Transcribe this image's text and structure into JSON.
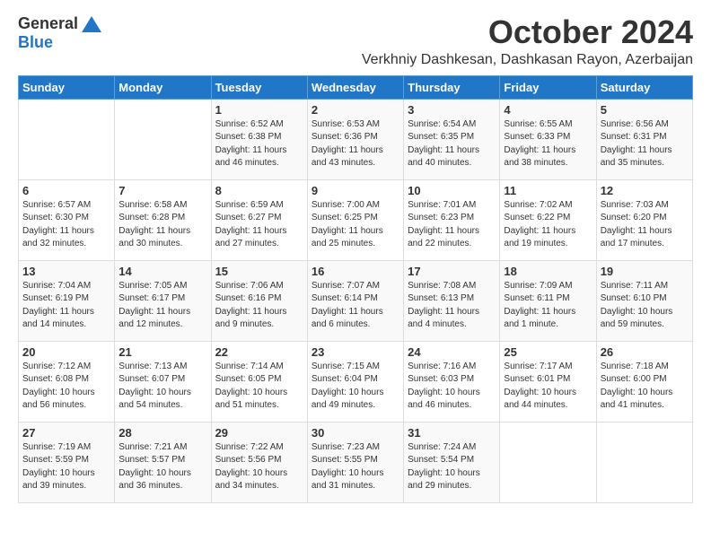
{
  "logo": {
    "general": "General",
    "blue": "Blue",
    "tagline": ""
  },
  "title": "October 2024",
  "location": "Verkhniy Dashkesan, Dashkasan Rayon, Azerbaijan",
  "days_of_week": [
    "Sunday",
    "Monday",
    "Tuesday",
    "Wednesday",
    "Thursday",
    "Friday",
    "Saturday"
  ],
  "weeks": [
    [
      {
        "day": "",
        "info": ""
      },
      {
        "day": "",
        "info": ""
      },
      {
        "day": "1",
        "info": "Sunrise: 6:52 AM\nSunset: 6:38 PM\nDaylight: 11 hours and 46 minutes."
      },
      {
        "day": "2",
        "info": "Sunrise: 6:53 AM\nSunset: 6:36 PM\nDaylight: 11 hours and 43 minutes."
      },
      {
        "day": "3",
        "info": "Sunrise: 6:54 AM\nSunset: 6:35 PM\nDaylight: 11 hours and 40 minutes."
      },
      {
        "day": "4",
        "info": "Sunrise: 6:55 AM\nSunset: 6:33 PM\nDaylight: 11 hours and 38 minutes."
      },
      {
        "day": "5",
        "info": "Sunrise: 6:56 AM\nSunset: 6:31 PM\nDaylight: 11 hours and 35 minutes."
      }
    ],
    [
      {
        "day": "6",
        "info": "Sunrise: 6:57 AM\nSunset: 6:30 PM\nDaylight: 11 hours and 32 minutes."
      },
      {
        "day": "7",
        "info": "Sunrise: 6:58 AM\nSunset: 6:28 PM\nDaylight: 11 hours and 30 minutes."
      },
      {
        "day": "8",
        "info": "Sunrise: 6:59 AM\nSunset: 6:27 PM\nDaylight: 11 hours and 27 minutes."
      },
      {
        "day": "9",
        "info": "Sunrise: 7:00 AM\nSunset: 6:25 PM\nDaylight: 11 hours and 25 minutes."
      },
      {
        "day": "10",
        "info": "Sunrise: 7:01 AM\nSunset: 6:23 PM\nDaylight: 11 hours and 22 minutes."
      },
      {
        "day": "11",
        "info": "Sunrise: 7:02 AM\nSunset: 6:22 PM\nDaylight: 11 hours and 19 minutes."
      },
      {
        "day": "12",
        "info": "Sunrise: 7:03 AM\nSunset: 6:20 PM\nDaylight: 11 hours and 17 minutes."
      }
    ],
    [
      {
        "day": "13",
        "info": "Sunrise: 7:04 AM\nSunset: 6:19 PM\nDaylight: 11 hours and 14 minutes."
      },
      {
        "day": "14",
        "info": "Sunrise: 7:05 AM\nSunset: 6:17 PM\nDaylight: 11 hours and 12 minutes."
      },
      {
        "day": "15",
        "info": "Sunrise: 7:06 AM\nSunset: 6:16 PM\nDaylight: 11 hours and 9 minutes."
      },
      {
        "day": "16",
        "info": "Sunrise: 7:07 AM\nSunset: 6:14 PM\nDaylight: 11 hours and 6 minutes."
      },
      {
        "day": "17",
        "info": "Sunrise: 7:08 AM\nSunset: 6:13 PM\nDaylight: 11 hours and 4 minutes."
      },
      {
        "day": "18",
        "info": "Sunrise: 7:09 AM\nSunset: 6:11 PM\nDaylight: 11 hours and 1 minute."
      },
      {
        "day": "19",
        "info": "Sunrise: 7:11 AM\nSunset: 6:10 PM\nDaylight: 10 hours and 59 minutes."
      }
    ],
    [
      {
        "day": "20",
        "info": "Sunrise: 7:12 AM\nSunset: 6:08 PM\nDaylight: 10 hours and 56 minutes."
      },
      {
        "day": "21",
        "info": "Sunrise: 7:13 AM\nSunset: 6:07 PM\nDaylight: 10 hours and 54 minutes."
      },
      {
        "day": "22",
        "info": "Sunrise: 7:14 AM\nSunset: 6:05 PM\nDaylight: 10 hours and 51 minutes."
      },
      {
        "day": "23",
        "info": "Sunrise: 7:15 AM\nSunset: 6:04 PM\nDaylight: 10 hours and 49 minutes."
      },
      {
        "day": "24",
        "info": "Sunrise: 7:16 AM\nSunset: 6:03 PM\nDaylight: 10 hours and 46 minutes."
      },
      {
        "day": "25",
        "info": "Sunrise: 7:17 AM\nSunset: 6:01 PM\nDaylight: 10 hours and 44 minutes."
      },
      {
        "day": "26",
        "info": "Sunrise: 7:18 AM\nSunset: 6:00 PM\nDaylight: 10 hours and 41 minutes."
      }
    ],
    [
      {
        "day": "27",
        "info": "Sunrise: 7:19 AM\nSunset: 5:59 PM\nDaylight: 10 hours and 39 minutes."
      },
      {
        "day": "28",
        "info": "Sunrise: 7:21 AM\nSunset: 5:57 PM\nDaylight: 10 hours and 36 minutes."
      },
      {
        "day": "29",
        "info": "Sunrise: 7:22 AM\nSunset: 5:56 PM\nDaylight: 10 hours and 34 minutes."
      },
      {
        "day": "30",
        "info": "Sunrise: 7:23 AM\nSunset: 5:55 PM\nDaylight: 10 hours and 31 minutes."
      },
      {
        "day": "31",
        "info": "Sunrise: 7:24 AM\nSunset: 5:54 PM\nDaylight: 10 hours and 29 minutes."
      },
      {
        "day": "",
        "info": ""
      },
      {
        "day": "",
        "info": ""
      }
    ]
  ]
}
